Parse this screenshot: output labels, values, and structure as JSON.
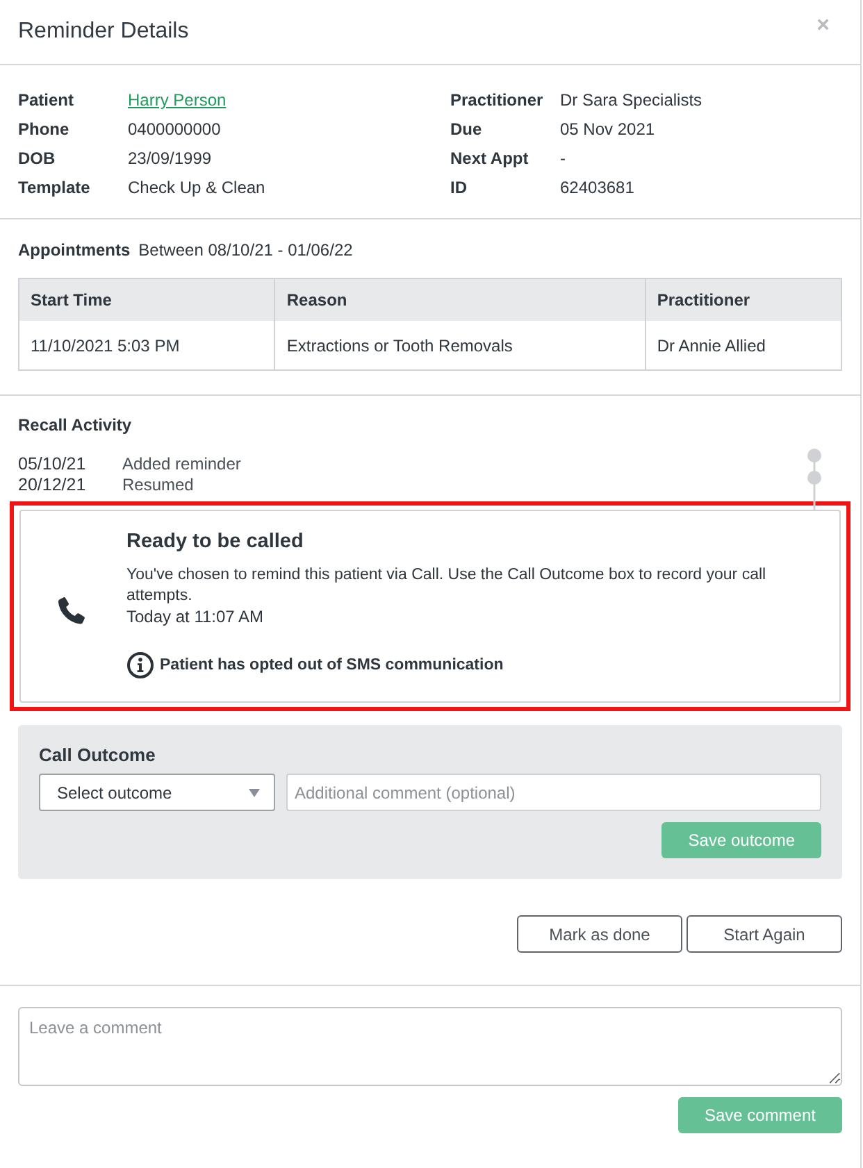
{
  "dialog": {
    "title": "Reminder Details",
    "close": "×"
  },
  "details": {
    "left": [
      {
        "label": "Patient",
        "value": "Harry Person",
        "kind": "link"
      },
      {
        "label": "Phone",
        "value": "0400000000",
        "kind": "text"
      },
      {
        "label": "DOB",
        "value": "23/09/1999",
        "kind": "text"
      },
      {
        "label": "Template",
        "value": "Check Up & Clean",
        "kind": "text"
      }
    ],
    "right": [
      {
        "label": "Practitioner",
        "value": "Dr Sara Specialists",
        "kind": "text"
      },
      {
        "label": "Due",
        "value": "05 Nov 2021",
        "kind": "text"
      },
      {
        "label": "Next Appt",
        "value": "-",
        "kind": "text"
      },
      {
        "label": "ID",
        "value": "62403681",
        "kind": "text"
      }
    ]
  },
  "appointments": {
    "label": "Appointments",
    "range": "Between 08/10/21 - 01/06/22",
    "columns": [
      "Start Time",
      "Reason",
      "Practitioner"
    ],
    "rows": [
      [
        "11/10/2021 5:03 PM",
        "Extractions or Tooth Removals",
        "Dr Annie Allied"
      ]
    ]
  },
  "recall_activity": {
    "title": "Recall Activity",
    "entries": [
      {
        "date": "05/10/21",
        "text": "Added reminder"
      },
      {
        "date": "20/12/21",
        "text": "Resumed"
      }
    ],
    "card": {
      "title": "Ready to be called",
      "message": "You've chosen to remind this patient via Call. Use the Call Outcome box to record your call attempts.",
      "time": "Today at 11:07 AM",
      "notice": "Patient has opted out of SMS communication",
      "highlighted": true
    }
  },
  "call_outcome": {
    "title": "Call Outcome",
    "select": {
      "value": "Select outcome"
    },
    "comment": {
      "placeholder": "Additional comment (optional)"
    },
    "button": "Save outcome"
  },
  "actions": [
    "Mark as done",
    "Start Again"
  ],
  "comment": {
    "placeholder": "Leave a comment",
    "button": "Save comment"
  }
}
